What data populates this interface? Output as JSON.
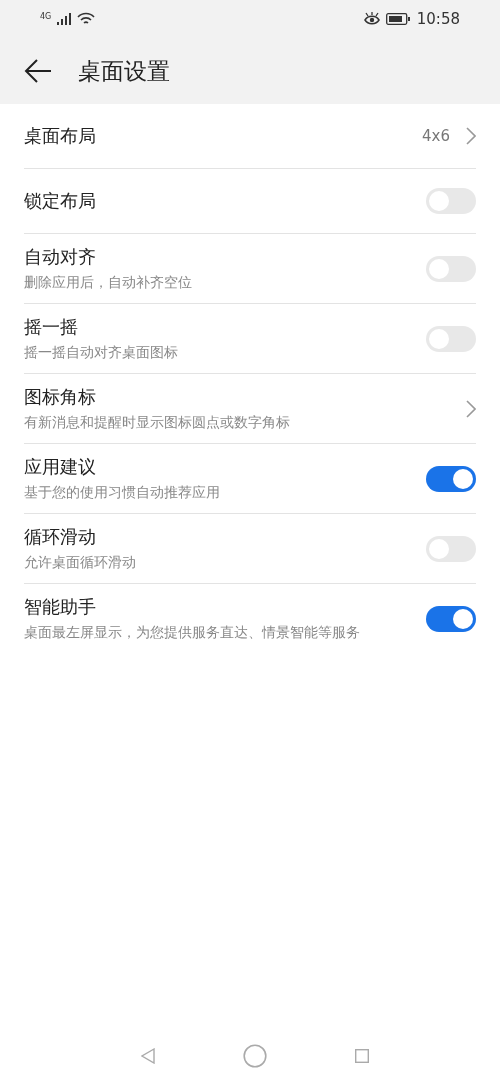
{
  "status_bar": {
    "network": "4G",
    "time": "10:58"
  },
  "header": {
    "title": "桌面设置"
  },
  "settings": [
    {
      "kind": "value",
      "title": "桌面布局",
      "value": "4x6"
    },
    {
      "kind": "toggle",
      "title": "锁定布局",
      "on": false
    },
    {
      "kind": "toggle",
      "title": "自动对齐",
      "subtitle": "删除应用后，自动补齐空位",
      "on": false
    },
    {
      "kind": "toggle",
      "title": "摇一摇",
      "subtitle": "摇一摇自动对齐桌面图标",
      "on": false
    },
    {
      "kind": "link",
      "title": "图标角标",
      "subtitle": "有新消息和提醒时显示图标圆点或数字角标"
    },
    {
      "kind": "toggle",
      "title": "应用建议",
      "subtitle": "基于您的使用习惯自动推荐应用",
      "on": true
    },
    {
      "kind": "toggle",
      "title": "循环滑动",
      "subtitle": "允许桌面循环滑动",
      "on": false
    },
    {
      "kind": "toggle",
      "title": "智能助手",
      "subtitle": "桌面最左屏显示，为您提供服务直达、情景智能等服务",
      "on": true
    }
  ]
}
